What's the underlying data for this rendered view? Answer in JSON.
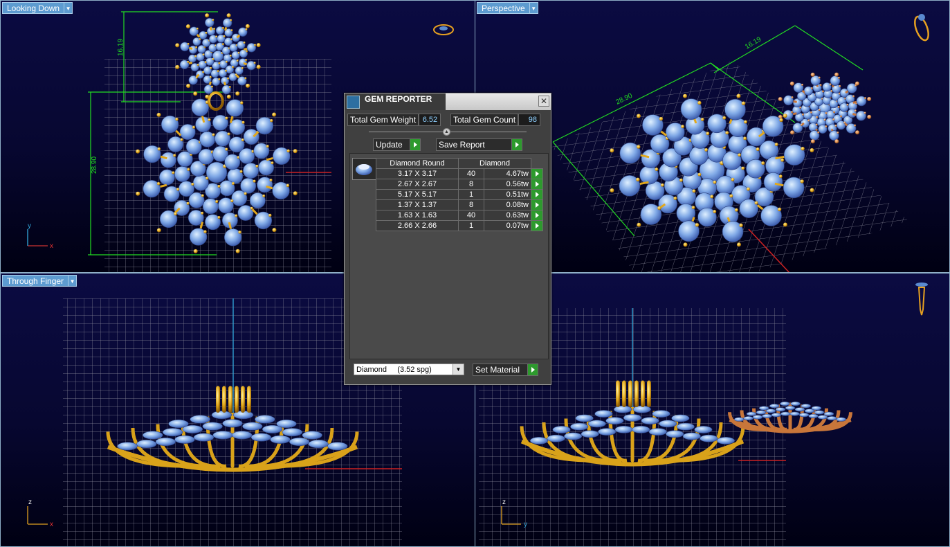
{
  "viewports": {
    "top_left": {
      "label": "Looking Down",
      "dims": [
        "16.19",
        "28.90"
      ],
      "axis_h": "x",
      "axis_v": "y"
    },
    "top_right": {
      "label": "Perspective",
      "dims": [
        "16.19",
        "28.90"
      ]
    },
    "bottom_left": {
      "label": "Through Finger",
      "axis_h": "x",
      "axis_v": "z"
    },
    "bottom_right": {
      "axis_h": "y",
      "axis_v": "z"
    }
  },
  "gem_reporter": {
    "title": "GEM REPORTER",
    "close": "✕",
    "total_weight_label": "Total Gem Weight",
    "total_weight_value": "6.52",
    "total_count_label": "Total Gem Count",
    "total_count_value": "98",
    "update_label": "Update",
    "save_label": "Save Report",
    "table_headers": [
      "Diamond Round",
      "Diamond"
    ],
    "rows": [
      {
        "size": "3.17 X 3.17",
        "count": "40",
        "weight": "4.67tw"
      },
      {
        "size": "2.67 X 2.67",
        "count": "8",
        "weight": "0.56tw"
      },
      {
        "size": "5.17 X 5.17",
        "count": "1",
        "weight": "0.51tw"
      },
      {
        "size": "1.37 X 1.37",
        "count": "8",
        "weight": "0.08tw"
      },
      {
        "size": "1.63 X 1.63",
        "count": "40",
        "weight": "0.63tw"
      },
      {
        "size": "2.66 X 2.66",
        "count": "1",
        "weight": "0.07tw"
      }
    ],
    "material_select": "Diamond     (3.52 spg)",
    "set_material_label": "Set Material"
  }
}
